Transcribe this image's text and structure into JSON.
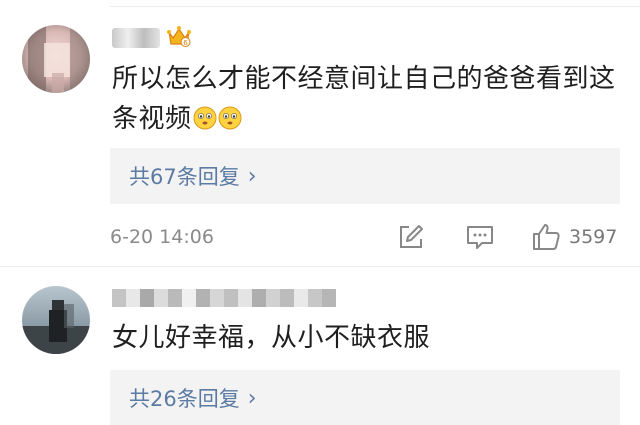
{
  "comments": [
    {
      "name": "■■■",
      "text_line1": "所以怎么才能不经意间让自己的爸爸看到这",
      "text_line2": "条视频",
      "emojis": [
        "thinking-face-icon",
        "thinking-face-icon"
      ],
      "replies_label": "共67条回复",
      "replies_arrow": "›",
      "timestamp": "6-20 14:06",
      "like_count": "3597"
    },
    {
      "name": "■■■■■■■■■■",
      "text_line1": "女儿好幸福，从小不缺衣服",
      "replies_label": "共26条回复",
      "replies_arrow": "›"
    }
  ],
  "colors": {
    "link_blue": "#5b7ba3",
    "reply_bg": "#f3f3f3",
    "meta_gray": "#8a8a8a",
    "vip_gold": "#f3b51b"
  }
}
